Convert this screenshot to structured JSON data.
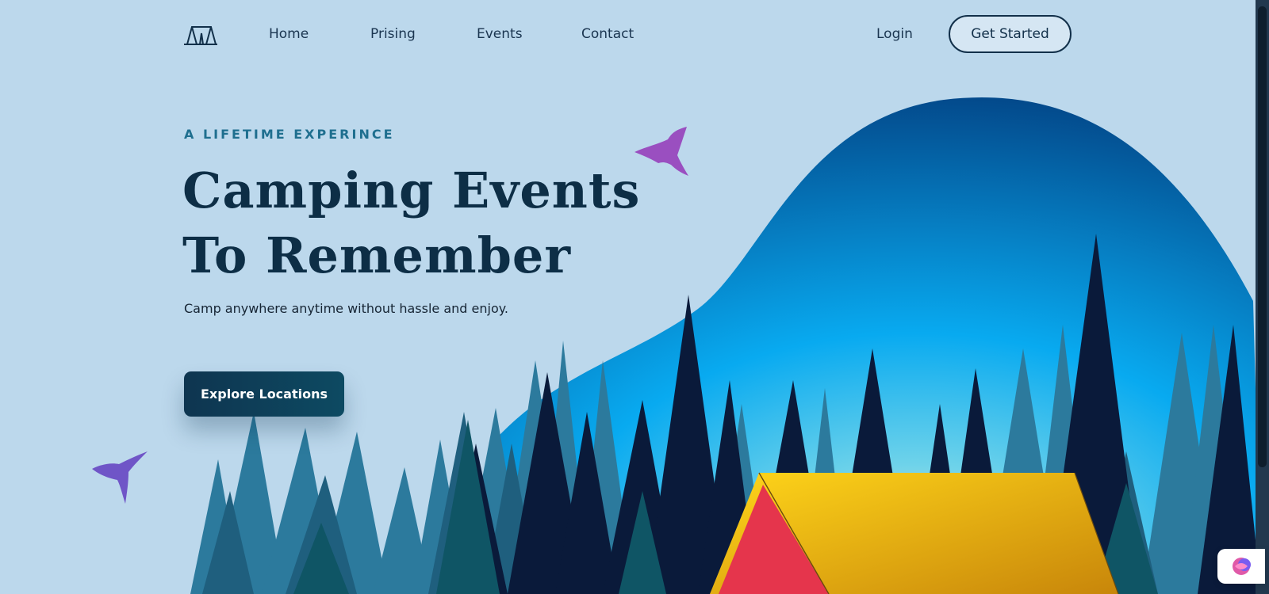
{
  "nav": {
    "logo_icon": "tent-icon",
    "links": [
      "Home",
      "Prising",
      "Events",
      "Contact"
    ],
    "login": "Login",
    "get_started": "Get Started"
  },
  "hero": {
    "eyebrow": "A LIFETIME EXPERINCE",
    "title_line1": "Camping Events",
    "title_line2": "To Remember",
    "subtitle": "Camp anywhere anytime without hassle and enjoy.",
    "cta": "Explore Locations"
  },
  "colors": {
    "background": "#bcd8ec",
    "primary_dark": "#0d2e46",
    "accent": "#1f6f8f",
    "tent_yellow": "#f5b800",
    "tent_red": "#e53a4e",
    "bird_purple": "#9a4fc0"
  },
  "icons": [
    "tent-icon",
    "hummingbird-icon",
    "brain-extension-icon"
  ]
}
